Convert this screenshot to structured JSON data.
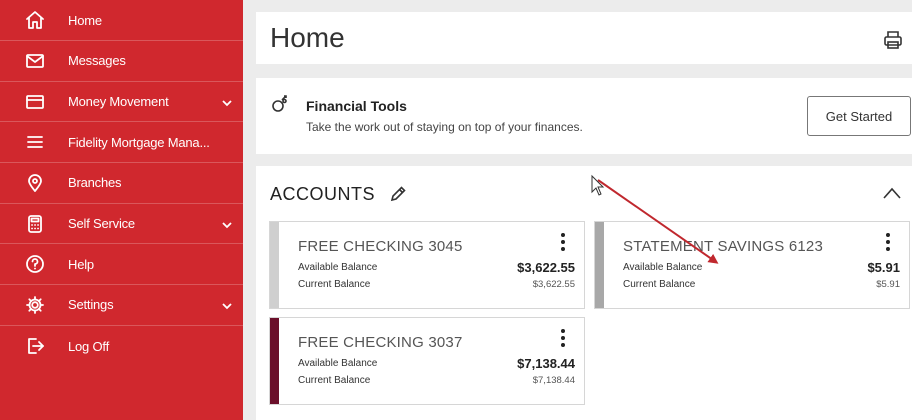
{
  "sidebar": {
    "items": [
      {
        "label": "Home",
        "icon": "home-icon",
        "chevron": false
      },
      {
        "label": "Messages",
        "icon": "envelope-icon",
        "chevron": false
      },
      {
        "label": "Money Movement",
        "icon": "card-icon",
        "chevron": true
      },
      {
        "label": "Fidelity Mortgage Mana...",
        "icon": "menu-lines-icon",
        "chevron": false
      },
      {
        "label": "Branches",
        "icon": "location-pin-icon",
        "chevron": false
      },
      {
        "label": "Self Service",
        "icon": "calculator-icon",
        "chevron": true
      },
      {
        "label": "Help",
        "icon": "question-icon",
        "chevron": false
      },
      {
        "label": "Settings",
        "icon": "gear-icon",
        "chevron": true
      },
      {
        "label": "Log Off",
        "icon": "logout-icon",
        "chevron": false
      }
    ]
  },
  "header": {
    "title": "Home"
  },
  "financial_tools": {
    "title": "Financial Tools",
    "subtitle": "Take the work out of staying on top of your finances.",
    "button": "Get Started"
  },
  "accounts": {
    "title": "ACCOUNTS",
    "list": [
      {
        "name": "FREE CHECKING 3045",
        "available_label": "Available Balance",
        "available": "$3,622.55",
        "current_label": "Current Balance",
        "current": "$3,622.55",
        "bar_color": "#cfcfcf"
      },
      {
        "name": "STATEMENT SAVINGS 6123",
        "available_label": "Available Balance",
        "available": "$5.91",
        "current_label": "Current Balance",
        "current": "$5.91",
        "bar_color": "#a8a8a8"
      },
      {
        "name": "FREE CHECKING 3037",
        "available_label": "Available Balance",
        "available": "$7,138.44",
        "current_label": "Current Balance",
        "current": "$7,138.44",
        "bar_color": "#6b0f2a"
      }
    ]
  },
  "colors": {
    "sidebar": "#d0282e",
    "annotation_arrow": "#c0282e"
  }
}
